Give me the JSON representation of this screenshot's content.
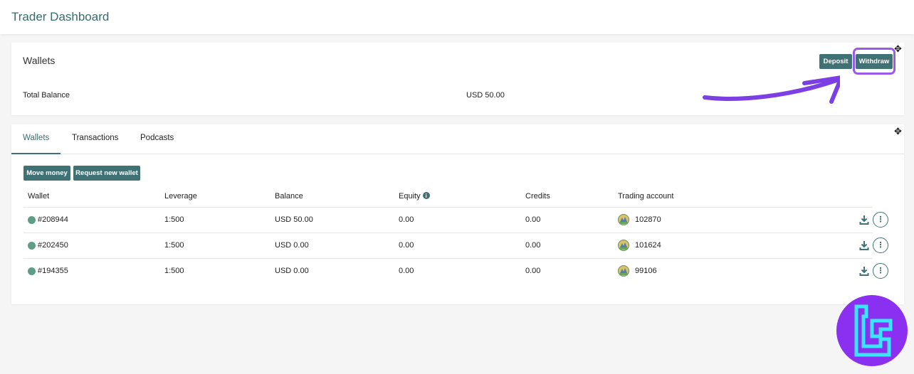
{
  "header": {
    "title": "Trader Dashboard"
  },
  "wallets_card": {
    "title": "Wallets",
    "total_balance_label": "Total Balance",
    "total_balance_value": "USD 50.00",
    "deposit_label": "Deposit",
    "withdraw_label": "Withdraw"
  },
  "tabs": [
    {
      "label": "Wallets",
      "active": true
    },
    {
      "label": "Transactions",
      "active": false
    },
    {
      "label": "Podcasts",
      "active": false
    }
  ],
  "actions": {
    "move_money_label": "Move money",
    "request_wallet_label": "Request new wallet"
  },
  "table": {
    "headers": [
      "Wallet",
      "Leverage",
      "Balance",
      "Equity",
      "Credits",
      "Trading account"
    ],
    "rows": [
      {
        "wallet": "#208944",
        "leverage": "1:500",
        "balance": "USD 50.00",
        "equity": "0.00",
        "credits": "0.00",
        "account": "102870"
      },
      {
        "wallet": "#202450",
        "leverage": "1:500",
        "balance": "USD 0.00",
        "equity": "0.00",
        "credits": "0.00",
        "account": "101624"
      },
      {
        "wallet": "#194355",
        "leverage": "1:500",
        "balance": "USD 0.00",
        "equity": "0.00",
        "credits": "0.00",
        "account": "99106"
      }
    ]
  },
  "icons": {
    "move": "move-icon",
    "info": "info-icon",
    "download": "download-icon",
    "more": "more-vertical-icon",
    "platform": "metatrader-icon",
    "status": "status-dot-icon"
  },
  "colors": {
    "accent": "#3f7175",
    "status_active": "#5e9d85",
    "highlight": "#9a59e6",
    "logo_bg": "#8b2ff0",
    "logo_fg": "#39e6ff"
  }
}
